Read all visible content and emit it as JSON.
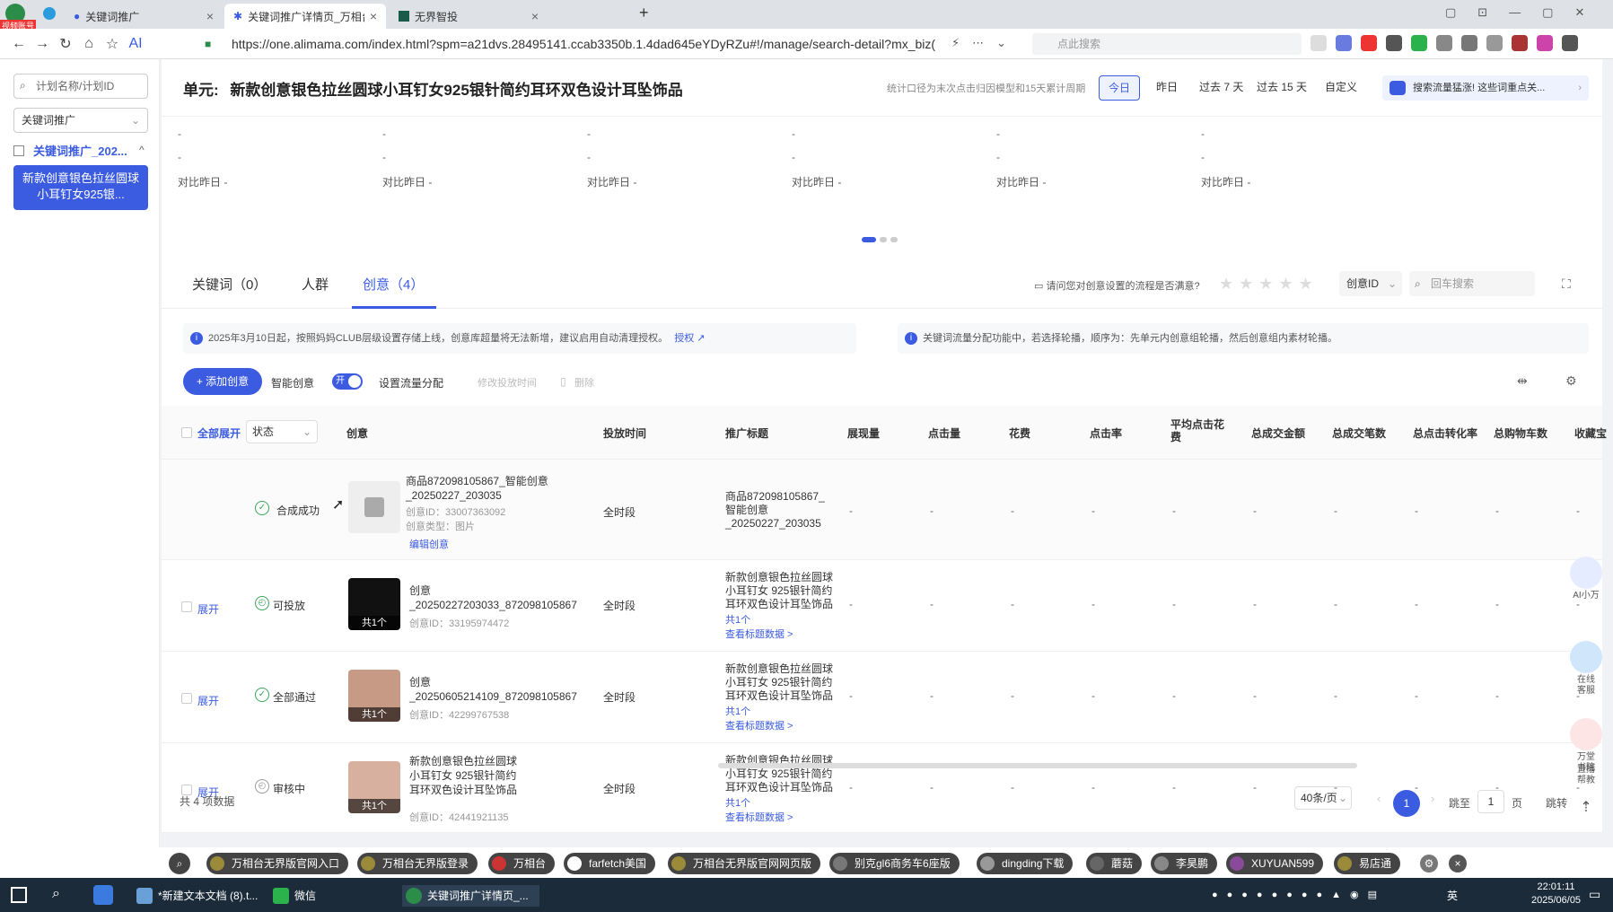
{
  "browser": {
    "tabs": [
      {
        "label": "关键词推广"
      },
      {
        "label": "关键词推广详情页_万相台无界"
      },
      {
        "label": "无界智投"
      }
    ],
    "url": "https://one.alimama.com/index.html?spm=a21dvs.28495141.ccab3350b.1.4dad645eYDyRZu#!/manage/search-detail?mx_biz(",
    "search_placeholder": "点此搜索",
    "badge": "视频账号"
  },
  "sidebar": {
    "search_placeholder": "计划名称/计划ID",
    "select_value": "关键词推广",
    "tree_item": "关键词推广_202...",
    "unit_item": "新款创意银色拉丝圆球小耳钉女925银..."
  },
  "header": {
    "unit_label": "单元:",
    "unit_title": "新款创意银色拉丝圆球小耳钉女925银针简约耳环双色设计耳坠饰品",
    "stat_note": "统计口径为末次点击归因模型和15天累计周期",
    "dates": [
      "今日",
      "昨日",
      "过去 7 天",
      "过去 15 天",
      "自定义"
    ],
    "promo": "搜索流量猛涨! 这些词重点关..."
  },
  "metrics": {
    "compare_label": "对比昨日 -",
    "dash": "-",
    "count": 6
  },
  "subtabs": {
    "keywords": "关键词（0）",
    "crowd": "人群",
    "creative": "创意（4）",
    "survey": "请问您对创意设置的流程是否满意?",
    "stars": "★★★★★",
    "id_select": "创意ID",
    "search_placeholder": "回车搜索"
  },
  "notices": {
    "left": "2025年3月10日起，按照妈妈CLUB层级设置存储上线，创意库超量将无法新增，建议启用自动清理授权。",
    "left_link": "授权",
    "right": "关键词流量分配功能中，若选择轮播，顺序为：先单元内创意组轮播，然后创意组内素材轮播。"
  },
  "toolbar": {
    "add_btn": "+ 添加创意",
    "smart_label": "智能创意",
    "toggle": "开",
    "flow_btn": "设置流量分配",
    "edit_time": "修改投放时间",
    "delete": "删除"
  },
  "table": {
    "headers": {
      "expand_all": "全部展开",
      "status": "状态",
      "creative": "创意",
      "time": "投放时间",
      "title": "推广标题",
      "impressions": "展现量",
      "clicks": "点击量",
      "cost": "花费",
      "ctr": "点击率",
      "avg_cpc_1": "平均点击花",
      "avg_cpc_2": "费",
      "gmv": "总成交金额",
      "orders": "总成交笔数",
      "cvr": "总点击转化率",
      "carts": "总购物车数",
      "fav": "收藏宝"
    },
    "rows": [
      {
        "expand": "",
        "status": "合成成功",
        "name": "商品872098105867_智能创意_20250227_203035",
        "id": "创意ID：33007363092",
        "meta2": "创意类型：图片",
        "action": "编辑创意",
        "time": "全时段",
        "title": "商品872098105867_智能创意_20250227_203035",
        "title_count": "",
        "title_link": "",
        "badge": ""
      },
      {
        "expand": "展开",
        "status": "可投放",
        "name": "创意_20250227203033_872098105867",
        "id": "创意ID：33195974472",
        "meta2": "",
        "action": "",
        "time": "全时段",
        "title": "新款创意银色拉丝圆球小耳钉女 925银针简约耳环双色设计耳坠饰品",
        "title_count": "共1个",
        "title_link": "查看标题数据 >",
        "badge": "共1个"
      },
      {
        "expand": "展开",
        "status": "全部通过",
        "name": "创意_20250605214109_872098105867",
        "id": "创意ID：42299767538",
        "meta2": "",
        "action": "",
        "time": "全时段",
        "title": "新款创意银色拉丝圆球小耳钉女 925银针简约耳环双色设计耳坠饰品",
        "title_count": "共1个",
        "title_link": "查看标题数据 >",
        "badge": "共1个"
      },
      {
        "expand": "展开",
        "status": "审核中",
        "name": "新款创意银色拉丝圆球小耳钉女 925银针简约耳环双色设计耳坠饰品",
        "id": "创意ID：42441921135",
        "meta2": "",
        "action": "",
        "time": "全时段",
        "title": "新款创意银色拉丝圆球小耳钉女 925银针简约耳环双色设计耳坠饰品",
        "title_count": "共1个",
        "title_link": "查看标题数据 >",
        "badge": "共1个"
      }
    ],
    "dash": "-"
  },
  "pagination": {
    "total": "共 4 项数据",
    "page_size": "40条/页",
    "current": "1",
    "jump_label": "跳至",
    "jump_value": "1",
    "page_unit": "页",
    "jump_btn": "跳转"
  },
  "rail": {
    "ai": "AI小万",
    "service_1": "在线",
    "service_2": "客服",
    "book_1": "万堂",
    "book_2": "书院",
    "live_1": "直播",
    "live_2": "帮教"
  },
  "bookmarks": [
    "万相台无界版官网入口",
    "万相台无界版登录",
    "万相台",
    "farfetch美国",
    "万相台无界版官网网页版",
    "别克gl6商务车6座版",
    "dingding下载",
    "蘑菇",
    "李昊鹏",
    "XUYUAN599",
    "易店通"
  ],
  "taskbar": {
    "items": [
      "*新建文本文档 (8).t...",
      "微信",
      "关键词推广详情页_..."
    ],
    "time": "22:01:11",
    "date": "2025/06/05",
    "lang": "英"
  },
  "colors": {
    "accent": "#3b5be0",
    "success": "#3aa65a"
  }
}
